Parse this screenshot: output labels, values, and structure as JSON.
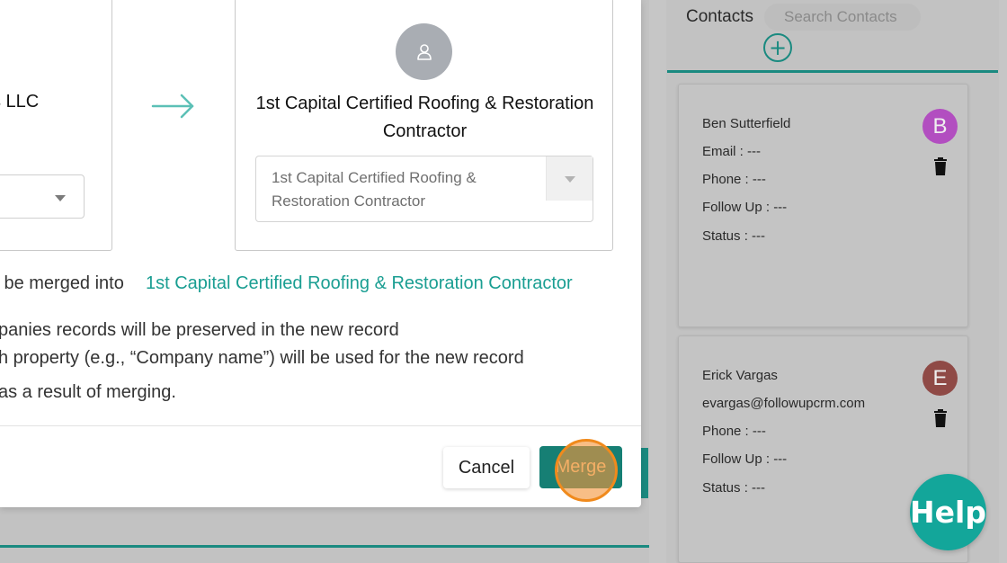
{
  "modal": {
    "left_company_name_fragment": "s LLC",
    "right_company_name": "1st Capital Certified Roofing & Restoration Contractor",
    "right_select_value": "1st Capital Certified Roofing & Restoration Contractor",
    "merge_sentence_lead": "ll be merged into",
    "merge_sentence_target": "1st Capital Certified Roofing & Restoration Contractor",
    "notes": [
      "panies records will be preserved in the new record",
      "h property (e.g., “Company name”) will be used for the new record",
      " as a result of merging."
    ],
    "cancel_label": "Cancel",
    "merge_label": "Merge"
  },
  "contacts": {
    "title": "Contacts",
    "search_placeholder": "Search Contacts",
    "add_symbol": "+",
    "cards": [
      {
        "name": "Ben Sutterfield",
        "email": "Email : ---",
        "phone": "Phone : ---",
        "follow_up": "Follow Up : ---",
        "status": "Status : ---",
        "initial": "B",
        "avatar_color": "#b24ec0"
      },
      {
        "name": "Erick Vargas",
        "email": "evargas@followupcrm.com",
        "phone": "Phone : ---",
        "follow_up": "Follow Up : ---",
        "status": "Status : ---",
        "initial": "E",
        "avatar_color": "#8f4a46"
      }
    ]
  },
  "help": {
    "label": "Help"
  },
  "colors": {
    "accent_teal": "#1a9e92",
    "merge_button": "#167f74",
    "click_marker": "#f08a1c"
  }
}
